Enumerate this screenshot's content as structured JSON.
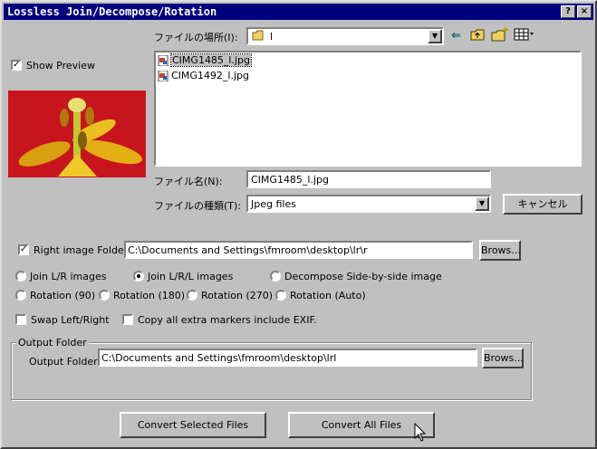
{
  "window": {
    "title": "Lossless Join/Decompose/Rotation",
    "help_label": "?",
    "close_label": "×"
  },
  "preview": {
    "show_label": "Show Preview",
    "checked": true
  },
  "file_dialog": {
    "location_label": "ファイルの場所(I):",
    "location_value": "l",
    "files": [
      "CIMG1485_l.jpg",
      "CIMG1492_l.jpg"
    ],
    "filename_label": "ファイル名(N):",
    "filename_value": "CIMG1485_l.jpg",
    "filetype_label": "ファイルの種類(T):",
    "filetype_value": "Jpeg files",
    "cancel_label": "キャンセル"
  },
  "right_folder": {
    "label": "Right image Folder :",
    "checked": true,
    "path": "C:\\Documents and Settings\\fmroom\\desktop\\lr\\r",
    "browse_label": "Brows..."
  },
  "modes": {
    "join_lr": "Join L/R images",
    "join_lrl": "Join L/R/L images",
    "decompose": "Decompose Side-by-side image",
    "rot90": "Rotation (90)",
    "rot180": "Rotation (180)",
    "rot270": "Rotation (270)",
    "rotauto": "Rotation (Auto)",
    "selected": "join_lrl"
  },
  "options": {
    "swap": "Swap Left/Right",
    "copy_markers": "Copy all extra markers include EXIF."
  },
  "output": {
    "group_label": "Output Folder",
    "label": "Output Folder :",
    "path": "C:\\Documents and Settings\\fmroom\\desktop\\lrl",
    "browse_label": "Brows..."
  },
  "actions": {
    "convert_selected": "Convert Selected Files",
    "convert_all": "Convert All Files"
  },
  "colors": {
    "titlebar": "#000080",
    "face": "#c0c0c0",
    "selection": "#000080"
  }
}
